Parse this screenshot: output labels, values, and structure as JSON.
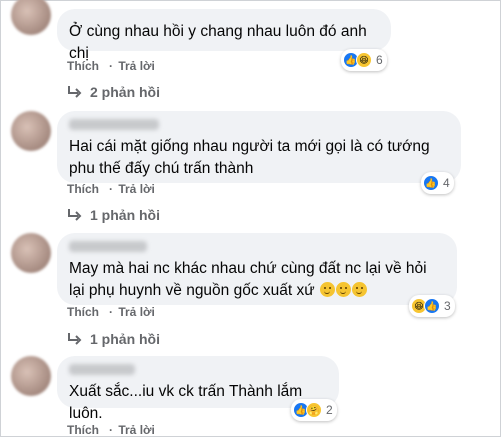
{
  "comments": [
    {
      "text": "Ở cùng nhau hồi y chang nhau luôn đó anh chị",
      "like_label": "Thích",
      "reply_label": "Trả lời",
      "reaction_count": "6",
      "replies_label": "2 phản hồi",
      "reactions": [
        "like-icon",
        "haha-icon"
      ]
    },
    {
      "text": "Hai cái mặt giống nhau người ta mới gọi là có tướng phu thế đấy chú trấn thành",
      "like_label": "Thích",
      "reply_label": "Trả lời",
      "reaction_count": "4",
      "replies_label": "1 phản hồi",
      "reactions": [
        "like-icon"
      ]
    },
    {
      "text": "May mà hai nc khác nhau chứ cùng đất nc lại về hỏi lại phụ huynh về nguồn gốc xuất xứ",
      "inline_emojis": [
        "thinking-emoji",
        "thinking-emoji",
        "thinking-emoji"
      ],
      "like_label": "Thích",
      "reply_label": "Trả lời",
      "reaction_count": "3",
      "replies_label": "1 phản hồi",
      "reactions": [
        "haha-icon",
        "like-icon"
      ]
    },
    {
      "text": "Xuất sắc...iu vk ck trấn Thành lắm luôn.",
      "like_label": "Thích",
      "reply_label": "Trả lời",
      "reaction_count": "2",
      "reactions": [
        "like-icon",
        "care-icon"
      ]
    }
  ],
  "colors": {
    "bubble": "#f0f2f5",
    "like": "#1877f2",
    "meta": "#65676b"
  }
}
